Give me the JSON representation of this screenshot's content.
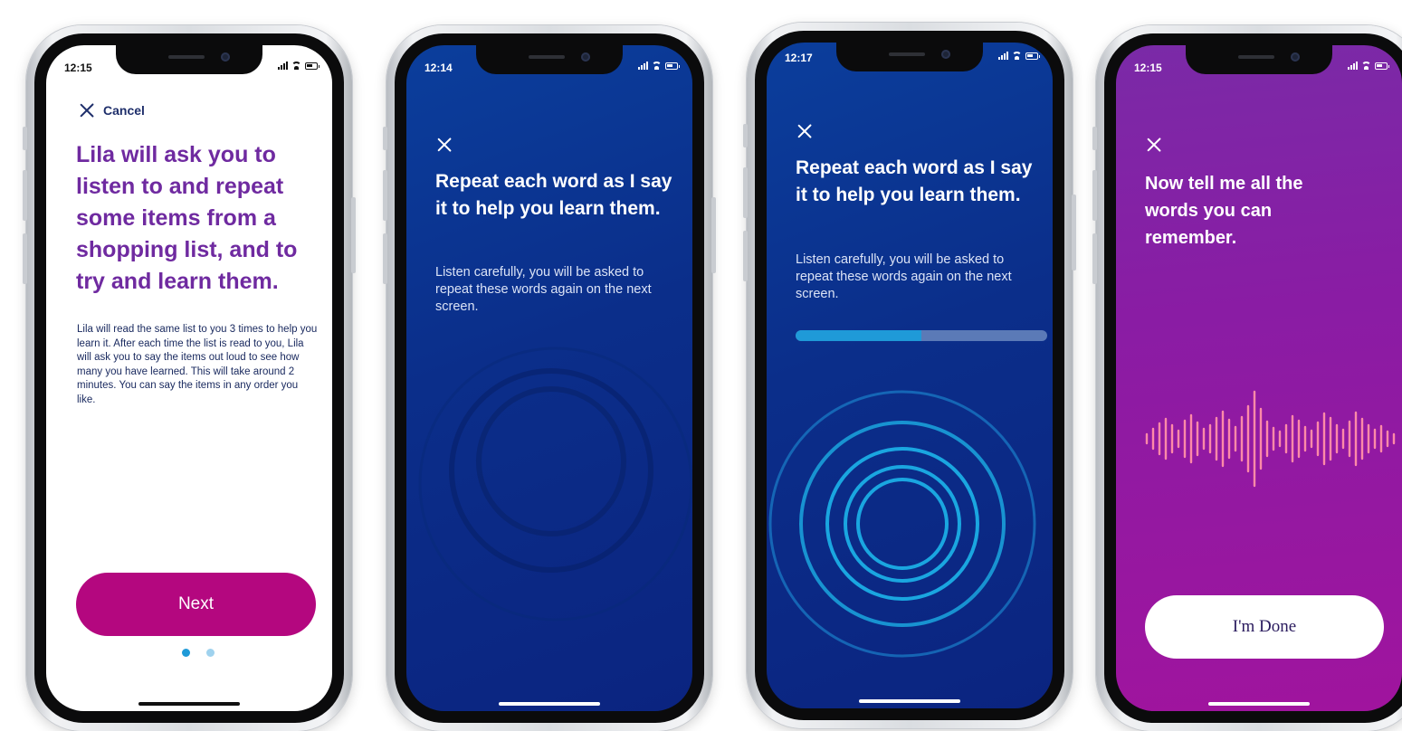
{
  "screens": [
    {
      "id": "intro",
      "time": "12:15",
      "cancel_label": "Cancel",
      "title": "Lila will ask you to listen to and repeat some items from a shopping list, and to try and learn them.",
      "description": "Lila will read the same list to you 3 times to help you learn it. After each time the list is read to you, Lila will ask you to say the items out loud to see how many you have learned. This will take around 2 minutes. You can say the items in any order you like.",
      "next_label": "Next",
      "page_dots": {
        "count": 2,
        "active": 1
      }
    },
    {
      "id": "listen",
      "time": "12:14",
      "title": "Repeat each word as I say it to help you learn them.",
      "subtitle": "Listen carefully, you will be asked to repeat these words again on the next screen."
    },
    {
      "id": "listen-progress",
      "time": "12:17",
      "title": "Repeat each word as I say it to help you learn them.",
      "subtitle": "Listen carefully, you will be asked to repeat these words again on the next screen.",
      "progress": 0.5
    },
    {
      "id": "recall",
      "time": "12:15",
      "title": "Now tell me all the words you can remember.",
      "done_label": "I'm Done"
    }
  ],
  "colors": {
    "title_purple": "#6f2aa0",
    "brand_magenta": "#b4077f",
    "navy_text": "#1b2b60",
    "blue_bg": "#0b2e8a",
    "progress_fill": "#1f9ad8",
    "ring_blue": "#1a9fd9",
    "purple_bg": "#8a1ca4",
    "wave_pink": "#ff8aa8"
  }
}
